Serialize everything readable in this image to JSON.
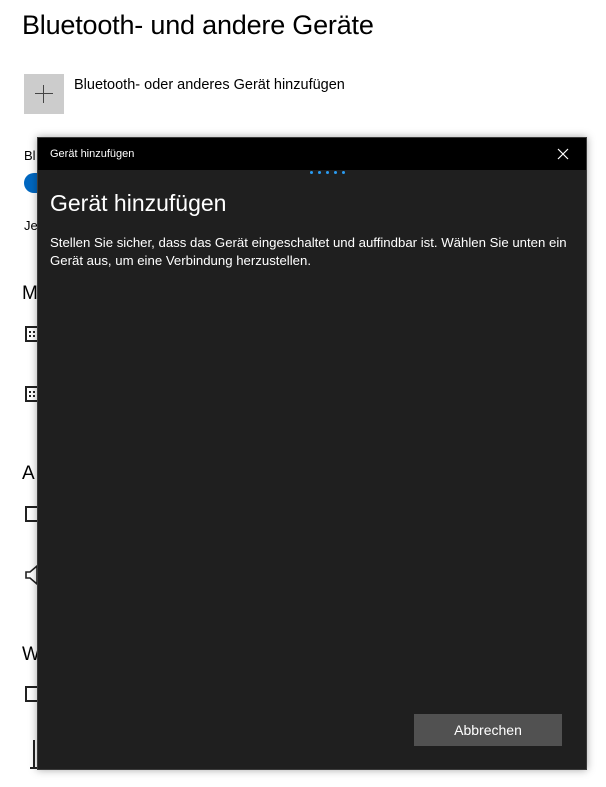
{
  "settings": {
    "title": "Bluetooth- und andere Geräte",
    "add_device_label": "Bluetooth- oder anderes Gerät hinzufügen",
    "fragments": {
      "bluetooth": "Bl",
      "visible": "Je",
      "mouse_section": "M",
      "audio_section": "A",
      "wireless_section": "W"
    }
  },
  "dialog": {
    "window_title": "Gerät hinzufügen",
    "heading": "Gerät hinzufügen",
    "description": "Stellen Sie sicher, dass das Gerät eingeschaltet und auffindbar ist. Wählen Sie unten ein Gerät aus, um eine Verbindung herzustellen.",
    "cancel_label": "Abbrechen",
    "close_icon": "close-icon",
    "progress_color": "#2a9bf0"
  },
  "colors": {
    "accent": "#0067c0",
    "dialog_bg": "#1f1f1f",
    "titlebar_bg": "#000000",
    "button_bg": "#515151"
  }
}
